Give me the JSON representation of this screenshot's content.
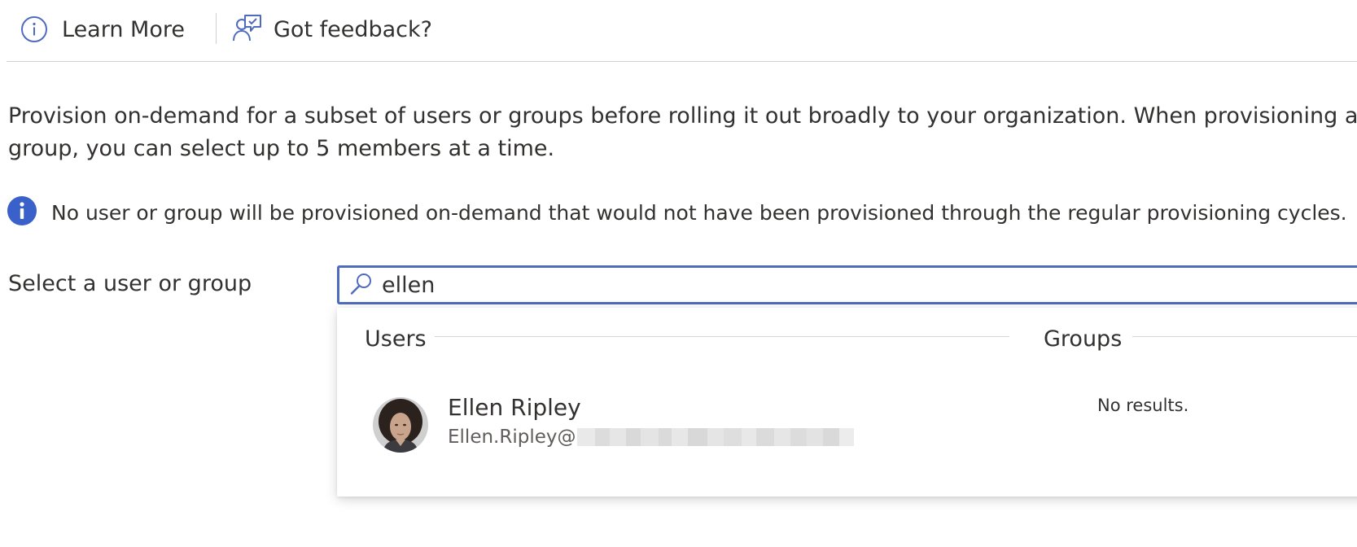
{
  "toolbar": {
    "learn_more": {
      "label": "Learn More",
      "icon": "info-circle-outline-icon"
    },
    "feedback": {
      "label": "Got feedback?",
      "icon": "person-feedback-icon"
    }
  },
  "description": "Provision on-demand for a subset of users or groups before rolling it out broadly to your organization. When provisioning a group, you can select up to 5 members at a time.",
  "info_banner": {
    "icon": "info-filled-icon",
    "text": "No user or group will be provisioned on-demand that would not have been provisioned through the regular provisioning cycles."
  },
  "select_field": {
    "label": "Select a user or group",
    "search_value": "ellen",
    "search_icon": "search-icon"
  },
  "results": {
    "users_heading": "Users",
    "groups_heading": "Groups",
    "users": [
      {
        "name": "Ellen Ripley",
        "email_prefix": "Ellen.Ripley@",
        "email_domain_redacted": true
      }
    ],
    "groups_empty_text": "No results."
  },
  "colors": {
    "accent": "#4f6bbd",
    "info_blue": "#3a61c9",
    "text": "#323130",
    "secondary_text": "#605e5c",
    "divider": "#d2d0ce"
  }
}
